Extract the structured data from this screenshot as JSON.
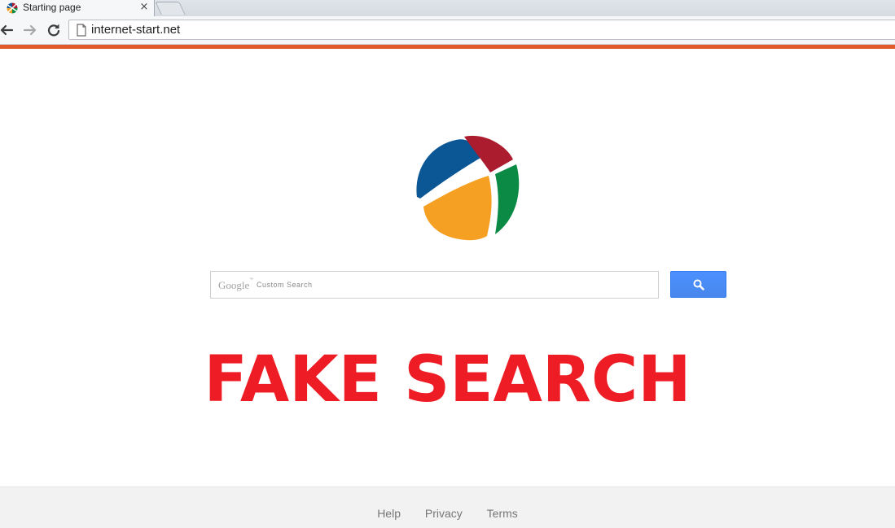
{
  "browser": {
    "tab": {
      "title": "Starting page",
      "close_glyph": "×",
      "favicon": "site-logo-icon"
    },
    "new_tab_icon": "new-tab-icon",
    "toolbar": {
      "back_icon": "back-arrow-icon",
      "forward_icon": "forward-arrow-icon",
      "reload_icon": "reload-icon",
      "page_icon": "page-icon",
      "url": "internet-start.net"
    },
    "accent_bar_color": "#e05a2a"
  },
  "page": {
    "logo": {
      "name": "four-color-x-logo",
      "colors": {
        "blue": "#0b5694",
        "red": "#ab1d2e",
        "green": "#0a8a45",
        "orange": "#f5a023"
      }
    },
    "search": {
      "brand": "Google",
      "brand_tm": "™",
      "label": "Custom Search",
      "value": ""
    },
    "search_button": {
      "icon": "magnifier-icon",
      "color": "#4d90fe"
    },
    "overlay_text": "FAKE SEARCH",
    "overlay_color": "#ee1c25"
  },
  "footer": {
    "links": [
      "Help",
      "Privacy",
      "Terms"
    ]
  }
}
